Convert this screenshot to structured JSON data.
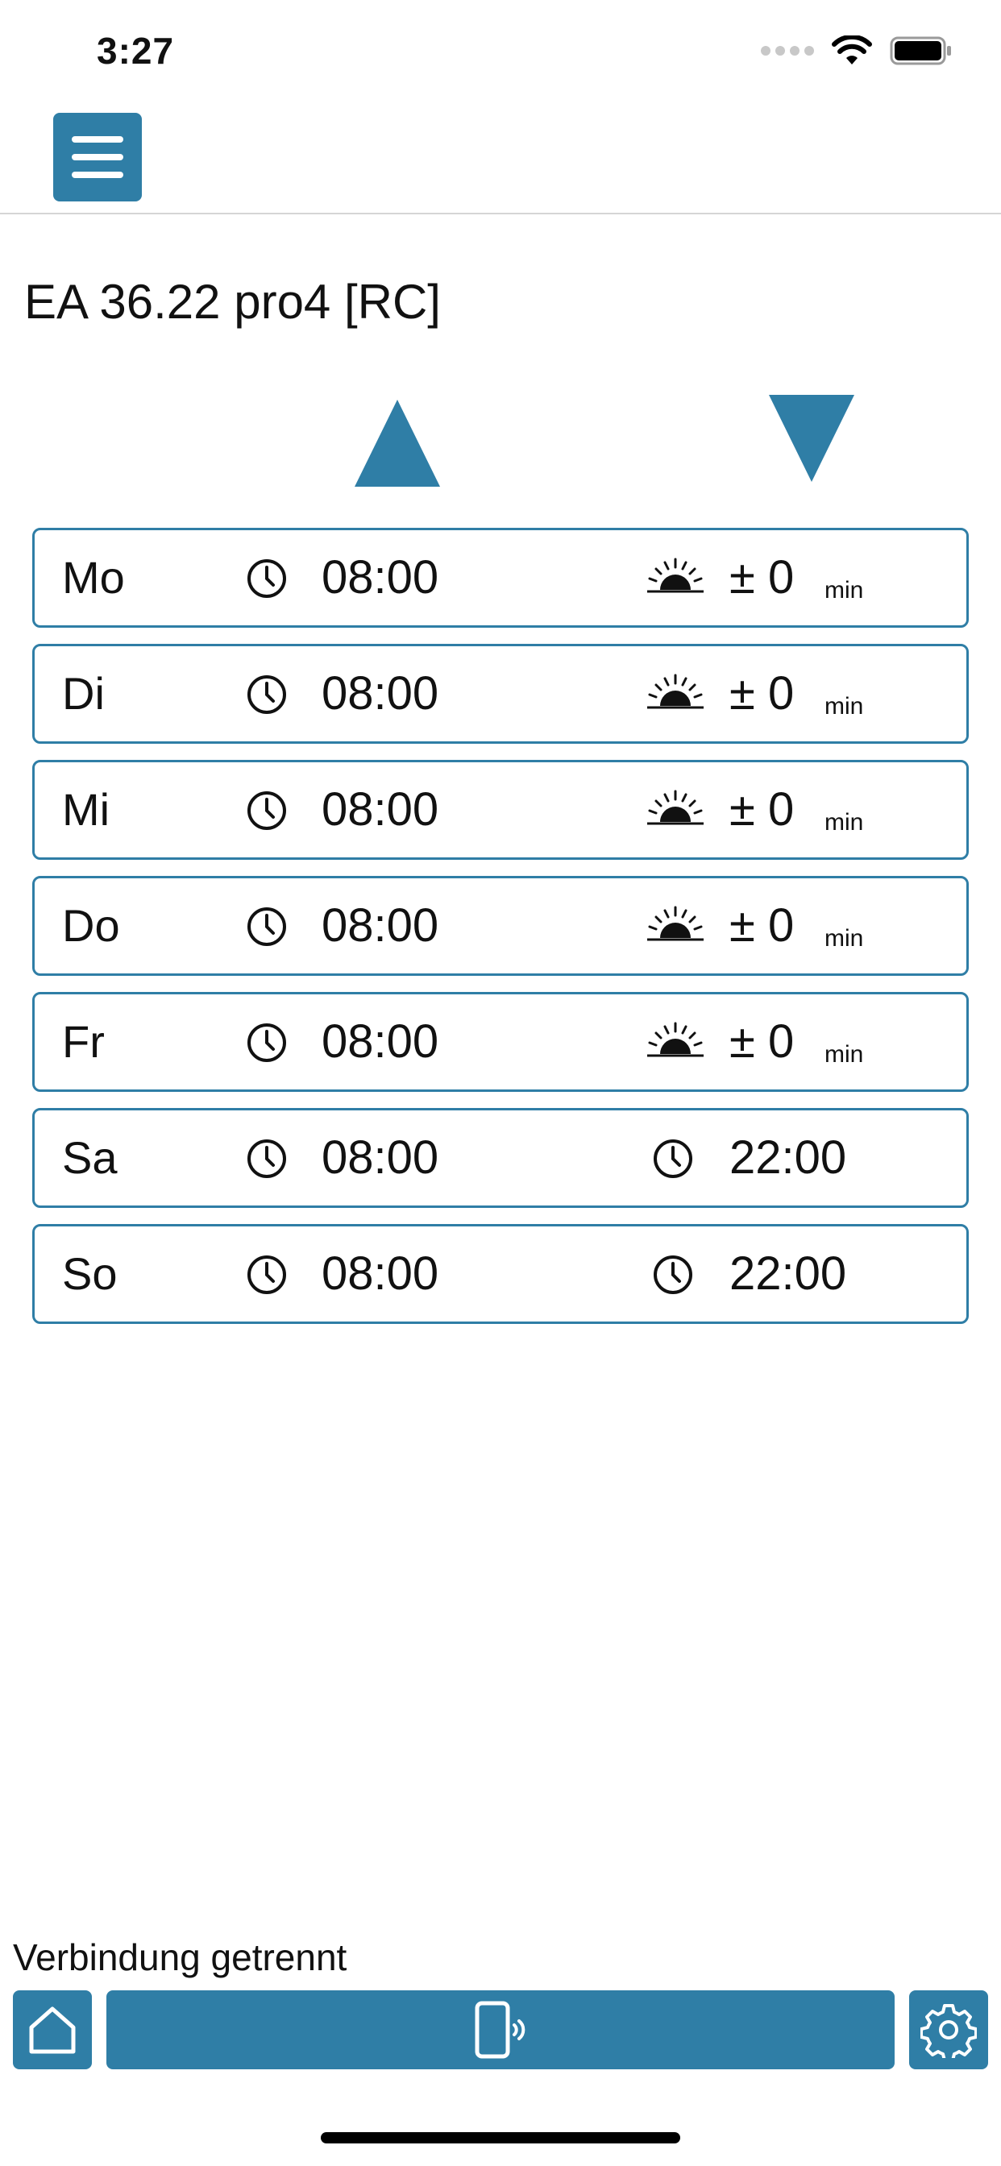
{
  "status_bar": {
    "time": "3:27",
    "icons": [
      "signal-dots-icon",
      "wifi-icon",
      "battery-icon"
    ]
  },
  "nav": {
    "menu_icon": "hamburger-menu-icon"
  },
  "device": {
    "title": "EA 36.22 pro4 [RC]"
  },
  "columns": {
    "up_icon": "triangle-up-icon",
    "down_icon": "triangle-down-icon"
  },
  "schedule": {
    "rows": [
      {
        "day": "Mo",
        "up_time": "08:00",
        "down_mode": "sunset",
        "offset": "± 0",
        "unit": "min",
        "down_time": ""
      },
      {
        "day": "Di",
        "up_time": "08:00",
        "down_mode": "sunset",
        "offset": "± 0",
        "unit": "min",
        "down_time": ""
      },
      {
        "day": "Mi",
        "up_time": "08:00",
        "down_mode": "sunset",
        "offset": "± 0",
        "unit": "min",
        "down_time": ""
      },
      {
        "day": "Do",
        "up_time": "08:00",
        "down_mode": "sunset",
        "offset": "± 0",
        "unit": "min",
        "down_time": ""
      },
      {
        "day": "Fr",
        "up_time": "08:00",
        "down_mode": "sunset",
        "offset": "± 0",
        "unit": "min",
        "down_time": ""
      },
      {
        "day": "Sa",
        "up_time": "08:00",
        "down_mode": "time",
        "offset": "",
        "unit": "",
        "down_time": "22:00"
      },
      {
        "day": "So",
        "up_time": "08:00",
        "down_mode": "time",
        "offset": "",
        "unit": "",
        "down_time": "22:00"
      }
    ]
  },
  "footer": {
    "connection_status": "Verbindung getrennt",
    "buttons": [
      "home-icon",
      "phone-signal-icon",
      "gear-icon"
    ]
  },
  "colors": {
    "accent": "#2f7ea6",
    "text": "#111111",
    "divider": "#d5d5d5",
    "background": "#ffffff"
  }
}
